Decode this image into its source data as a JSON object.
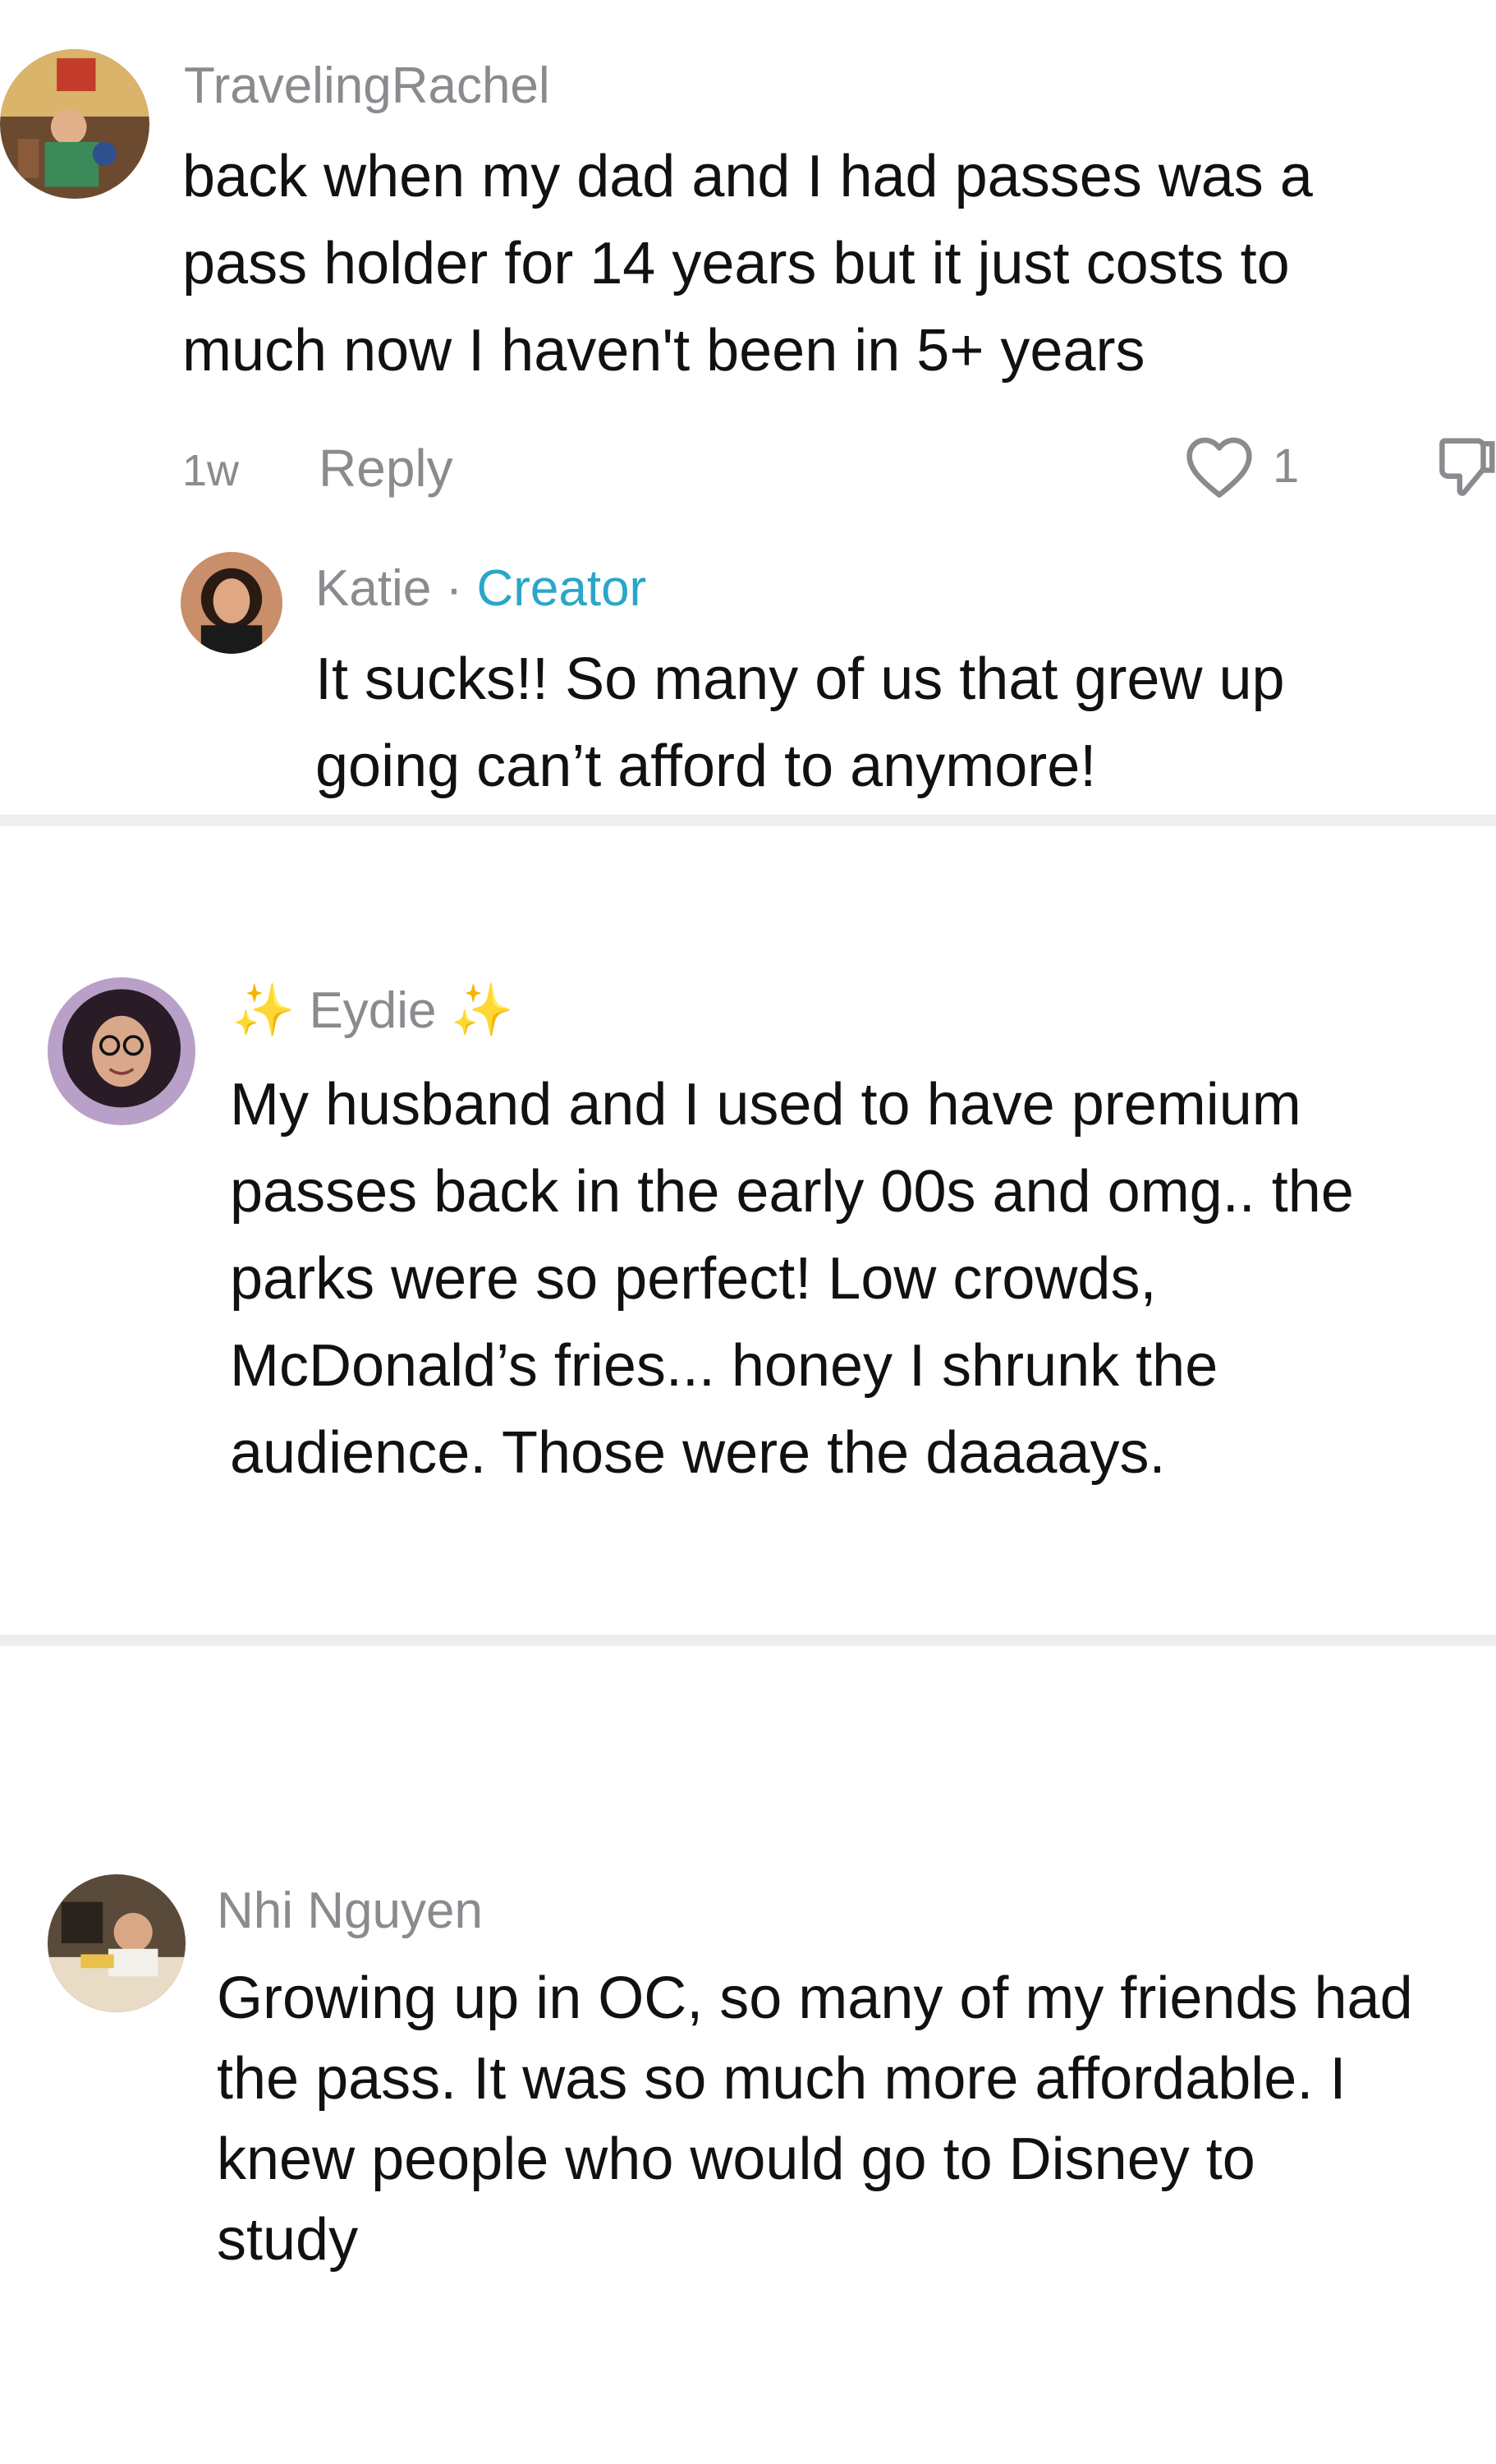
{
  "comments": [
    {
      "username": "TravelingRachel",
      "text_lines": [
        "back when my dad and I had passes was a",
        "pass holder for 14 years but it just costs to",
        "much now I haven't been in 5+ years"
      ],
      "time": "1w",
      "reply_label": "Reply",
      "like_count": "1",
      "reply": {
        "username": "Katie",
        "separator": "·",
        "badge": "Creator",
        "text_lines": [
          "It sucks!! So many of us that grew up",
          "going can’t afford to anymore!"
        ]
      }
    },
    {
      "username": "Eydie",
      "sparkle": "✨",
      "text_lines": [
        "My husband and I used to have premium",
        "passes back in the early 00s and omg.. the",
        "parks were so perfect! Low crowds,",
        "McDonald’s fries... honey I shrunk the",
        "audience. Those were the daaaays."
      ]
    },
    {
      "username": "Nhi Nguyen",
      "text_lines": [
        "Growing up in OC, so many of my friends had",
        "the pass. It was so much more affordable. I",
        "knew people who would go to Disney to",
        "study"
      ]
    }
  ],
  "colors": {
    "muted": "#8a8a8f",
    "creator": "#2aa6c9",
    "text": "#111111",
    "divider": "#eeeeef"
  },
  "icons": {
    "like": "heart-outline-icon",
    "dislike": "thumbs-down-icon"
  }
}
